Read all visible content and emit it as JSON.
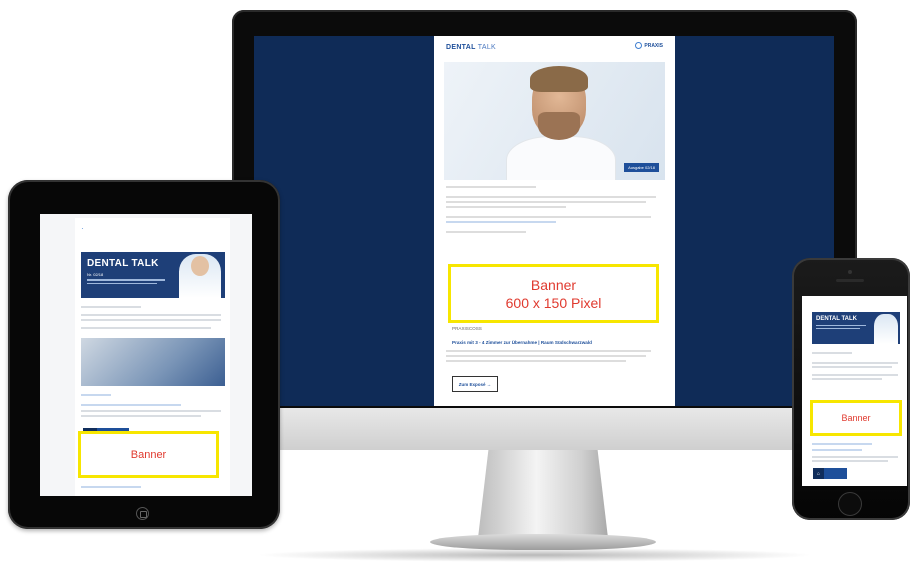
{
  "monitor": {
    "brand": "DENTAL",
    "brand_light": "TALK",
    "logo": "PRAXIS",
    "hero_tag": "Ausgabe 02/18",
    "banner_line1": "Banner",
    "banner_line2": "600 x 150 Pixel",
    "section_label": "PRAXISCOSS",
    "listing_title": "Praxis mit 3 - 4 Zimmer zur Übernahme | Raum Südschwarzwald",
    "button_label": "Zum Exposé →"
  },
  "tablet": {
    "headline": "DENTAL TALK",
    "issue": "Nr. 02/18",
    "banner_label": "Banner"
  },
  "phone": {
    "headline": "DENTAL TALK",
    "banner_label": "Banner"
  },
  "colors": {
    "screen_background": "#0f2b57",
    "brand_blue": "#1e4f9a",
    "banner_border": "#f7e600",
    "banner_text": "#e03a2f"
  }
}
